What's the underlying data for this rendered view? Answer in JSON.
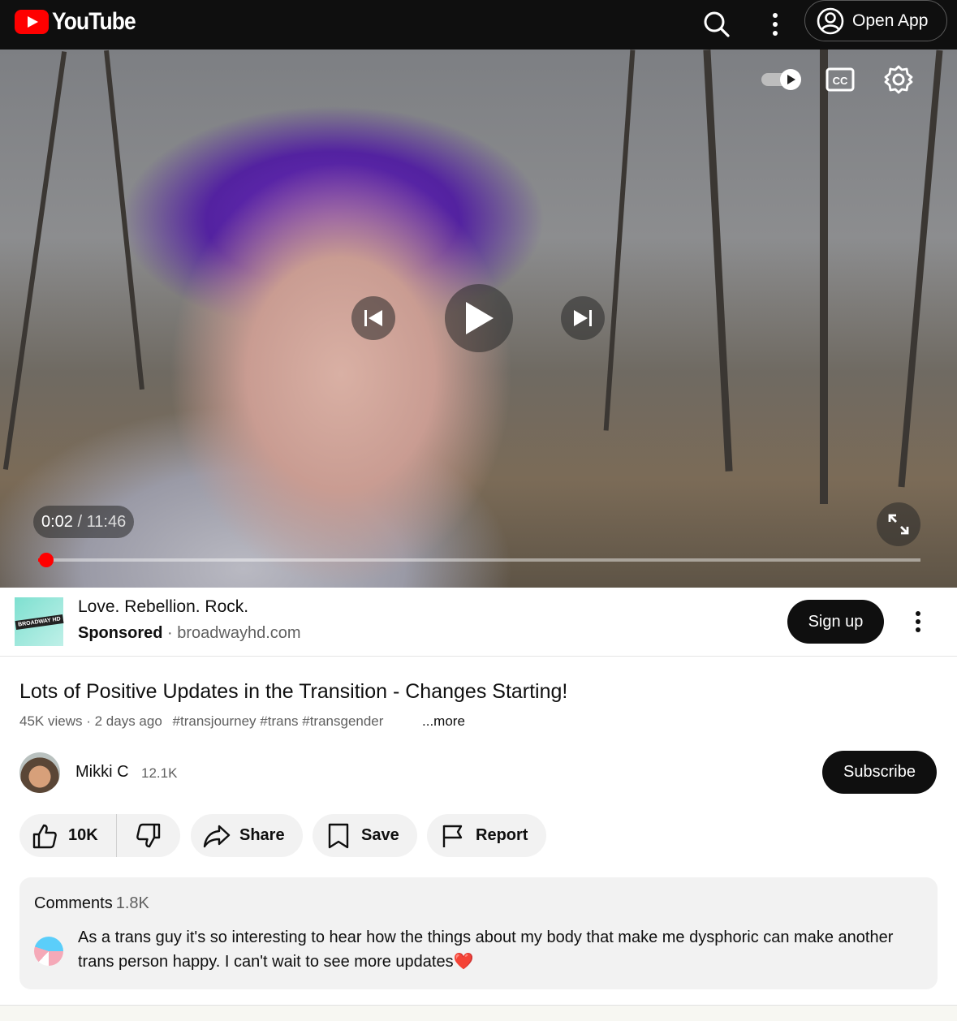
{
  "header": {
    "logo_text": "YouTube",
    "open_app_label": "Open App",
    "icons": [
      "search-icon",
      "more-vert-icon",
      "account-circle-icon"
    ]
  },
  "player": {
    "time_current": "0:02",
    "time_separator": "/",
    "time_total": "11:46",
    "progress_fraction": 0.003,
    "autoplay_on": true,
    "controls": [
      "autoplay-toggle",
      "captions-icon",
      "settings-icon",
      "previous-icon",
      "play-icon",
      "next-icon",
      "fullscreen-icon"
    ]
  },
  "ad": {
    "title": "Love. Rebellion. Rock.",
    "sponsored_label": "Sponsored",
    "separator": "·",
    "domain": "broadwayhd.com",
    "thumb_text": "BROADWAY HD",
    "cta_label": "Sign up"
  },
  "video": {
    "title": "Lots of Positive Updates in the Transition - Changes Starting!",
    "views": "45K views",
    "dot": "·",
    "age": "2 days ago",
    "tags": "#transjourney #trans #transgender",
    "more_label": "...more"
  },
  "channel": {
    "name": "Mikki C",
    "subscribers": "12.1K",
    "subscribe_label": "Subscribe"
  },
  "actions": {
    "likes": "10K",
    "share_label": "Share",
    "save_label": "Save",
    "report_label": "Report"
  },
  "comments": {
    "heading": "Comments",
    "count": "1.8K",
    "top_comment": "As a trans guy it's so interesting to hear how the things about my body that make me dysphoric can make another trans person happy. I can't wait to see more updates",
    "top_comment_emoji": "❤️"
  },
  "colors": {
    "brand_red": "#ff0000",
    "header_bg": "#0f0f0f",
    "pill_bg": "#f2f2f2",
    "secondary_text": "#606060"
  }
}
